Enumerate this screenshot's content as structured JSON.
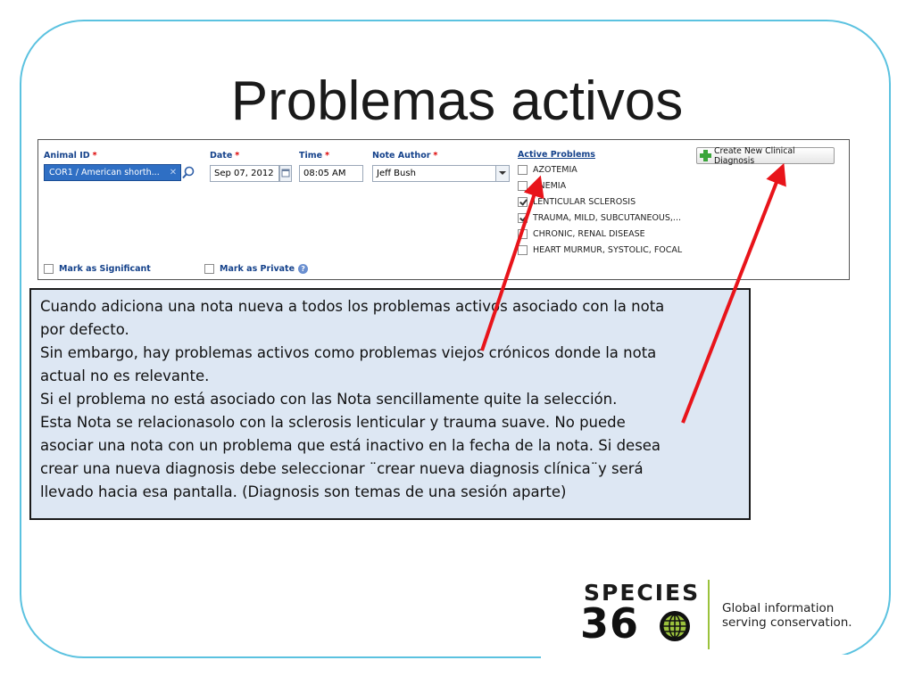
{
  "slide": {
    "title": "Problemas activos"
  },
  "form": {
    "animal_id": {
      "label": "Animal ID",
      "required": "*",
      "value": "COR1 / American shorth...",
      "clear_icon": "close-icon"
    },
    "date": {
      "label": "Date",
      "required": "*",
      "value": "Sep 07, 2012"
    },
    "time": {
      "label": "Time",
      "required": "*",
      "value": "08:05 AM"
    },
    "note_author": {
      "label": "Note Author",
      "required": "*",
      "value": "Jeff Bush"
    },
    "active_problems": {
      "label": "Active Problems",
      "items": [
        {
          "label": "AZOTEMIA",
          "checked": false
        },
        {
          "label": "ANEMIA",
          "checked": false
        },
        {
          "label": "LENTICULAR SCLEROSIS",
          "checked": true
        },
        {
          "label": "TRAUMA, MILD, SUBCUTANEOUS,...",
          "checked": true
        },
        {
          "label": "CHRONIC, RENAL DISEASE",
          "checked": false
        },
        {
          "label": "HEART MURMUR, SYSTOLIC, FOCAL",
          "checked": false
        }
      ]
    },
    "create_button": "Create New Clinical Diagnosis",
    "mark_significant": "Mark as Significant",
    "mark_private": "Mark as Private",
    "help_glyph": "?"
  },
  "note": {
    "lines": [
      "Cuando adiciona una nota nueva a todos los problemas activos asociado con la nota",
      "por defecto.",
      "Sin embargo, hay problemas activos como problemas viejos crónicos donde la nota",
      "actual no es relevante.",
      "Si el problema no está asociado con las Nota sencillamente quite la selección.",
      "Esta Nota se relacionasolo con la sclerosis lenticular y trauma suave. No puede",
      "asociar una nota con un problema que está inactivo en la fecha de la nota. Si desea",
      "crear una nueva diagnosis debe seleccionar ¨crear nueva diagnosis clínica¨y será",
      "llevado hacia esa pantalla.  (Diagnosis son temas de una sesión aparte)"
    ]
  },
  "logo": {
    "word": "SPECIES",
    "number": "36",
    "tagline_1": "Global information",
    "tagline_2": "serving conservation."
  },
  "colors": {
    "frame": "#5bc2e0",
    "label_blue": "#15428b",
    "arrow": "#e8141a",
    "note_bg": "#dde7f3",
    "logo_green": "#9bc23c"
  }
}
